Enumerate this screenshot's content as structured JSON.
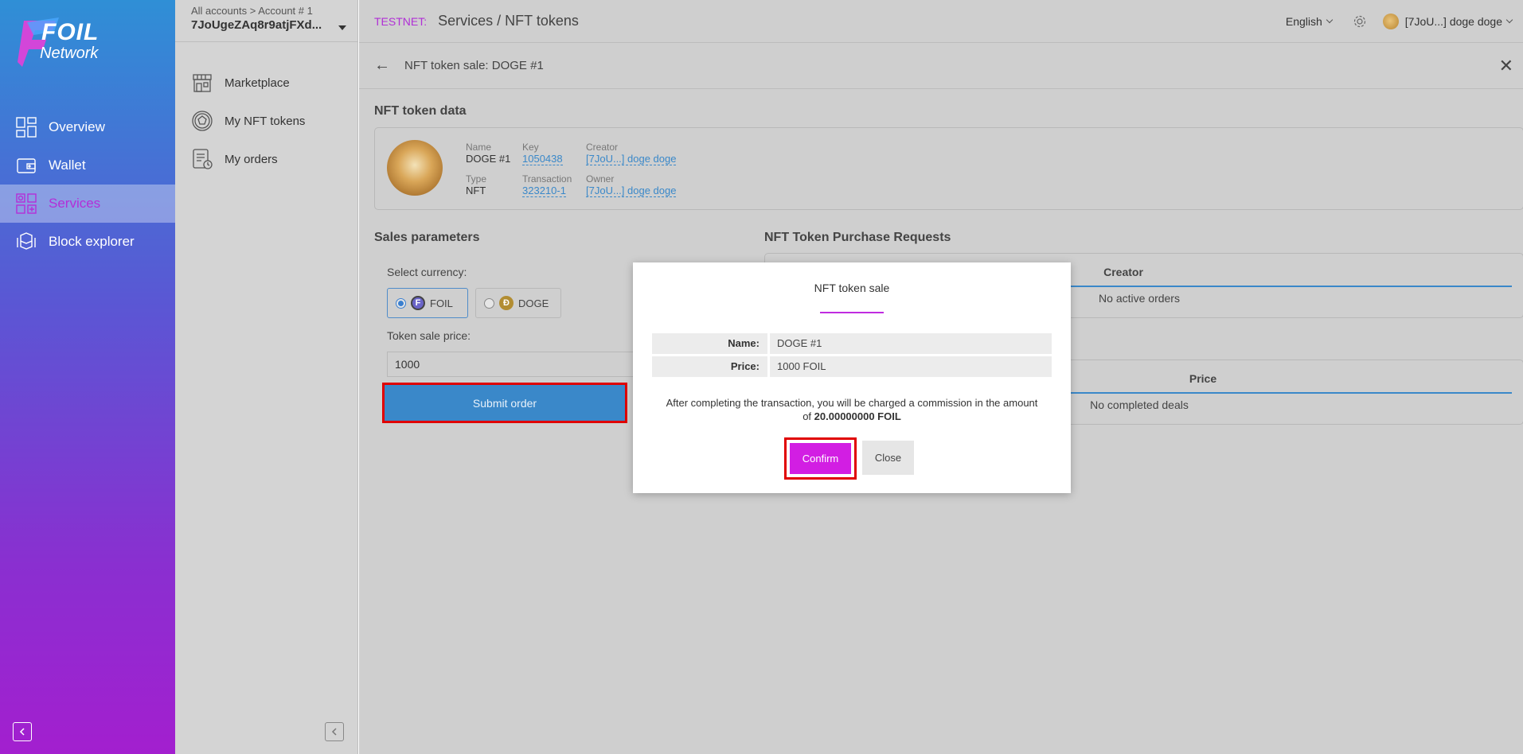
{
  "brand": {
    "line1": "FOIL",
    "line2": "Network"
  },
  "sidebar": {
    "items": [
      {
        "label": "Overview",
        "icon": "dashboard-icon"
      },
      {
        "label": "Wallet",
        "icon": "wallet-icon"
      },
      {
        "label": "Services",
        "icon": "services-icon",
        "active": true
      },
      {
        "label": "Block explorer",
        "icon": "cubes-icon"
      }
    ]
  },
  "account": {
    "path": "All accounts > Account # 1",
    "id": "7JoUgeZAq8r9atjFXd..."
  },
  "subnav": {
    "items": [
      {
        "label": "Marketplace",
        "icon": "store-icon"
      },
      {
        "label": "My NFT tokens",
        "icon": "nft-token-icon"
      },
      {
        "label": "My orders",
        "icon": "orders-icon"
      }
    ]
  },
  "topbar": {
    "network": "TESTNET:",
    "breadcrumb": "Services / NFT tokens",
    "language": "English",
    "user": "[7JoU...] doge doge"
  },
  "subheader": {
    "title": "NFT token sale: DOGE #1"
  },
  "nft_data": {
    "section_title": "NFT token data",
    "name_label": "Name",
    "name": "DOGE #1",
    "type_label": "Type",
    "type": "NFT",
    "key_label": "Key",
    "key": "1050438",
    "tx_label": "Transaction",
    "tx": "323210-1",
    "creator_label": "Creator",
    "creator": "[7JoU...] doge doge",
    "owner_label": "Owner",
    "owner": "[7JoU...] doge doge"
  },
  "sales": {
    "section_title": "Sales parameters",
    "currency_label": "Select currency:",
    "currencies": [
      {
        "label": "FOIL",
        "selected": true
      },
      {
        "label": "DOGE",
        "selected": false
      }
    ],
    "price_label": "Token sale price:",
    "price_value": "1000",
    "submit_label": "Submit order"
  },
  "requests": {
    "section_title": "NFT Token Purchase Requests",
    "col_creator": "Creator",
    "empty_orders": "No active orders",
    "col_price": "Price",
    "empty_deals": "No completed deals"
  },
  "modal": {
    "title": "NFT token sale",
    "name_label": "Name:",
    "name_value": "DOGE #1",
    "price_label": "Price:",
    "price_value": "1000 FOIL",
    "note_prefix": "After completing the transaction, you will be charged a commission in the amount of",
    "note_amount": "20.00000000 FOIL",
    "confirm_label": "Confirm",
    "close_label": "Close"
  },
  "colors": {
    "accent": "#d21ee3",
    "link": "#3a88c9",
    "highlight": "#e00000"
  }
}
